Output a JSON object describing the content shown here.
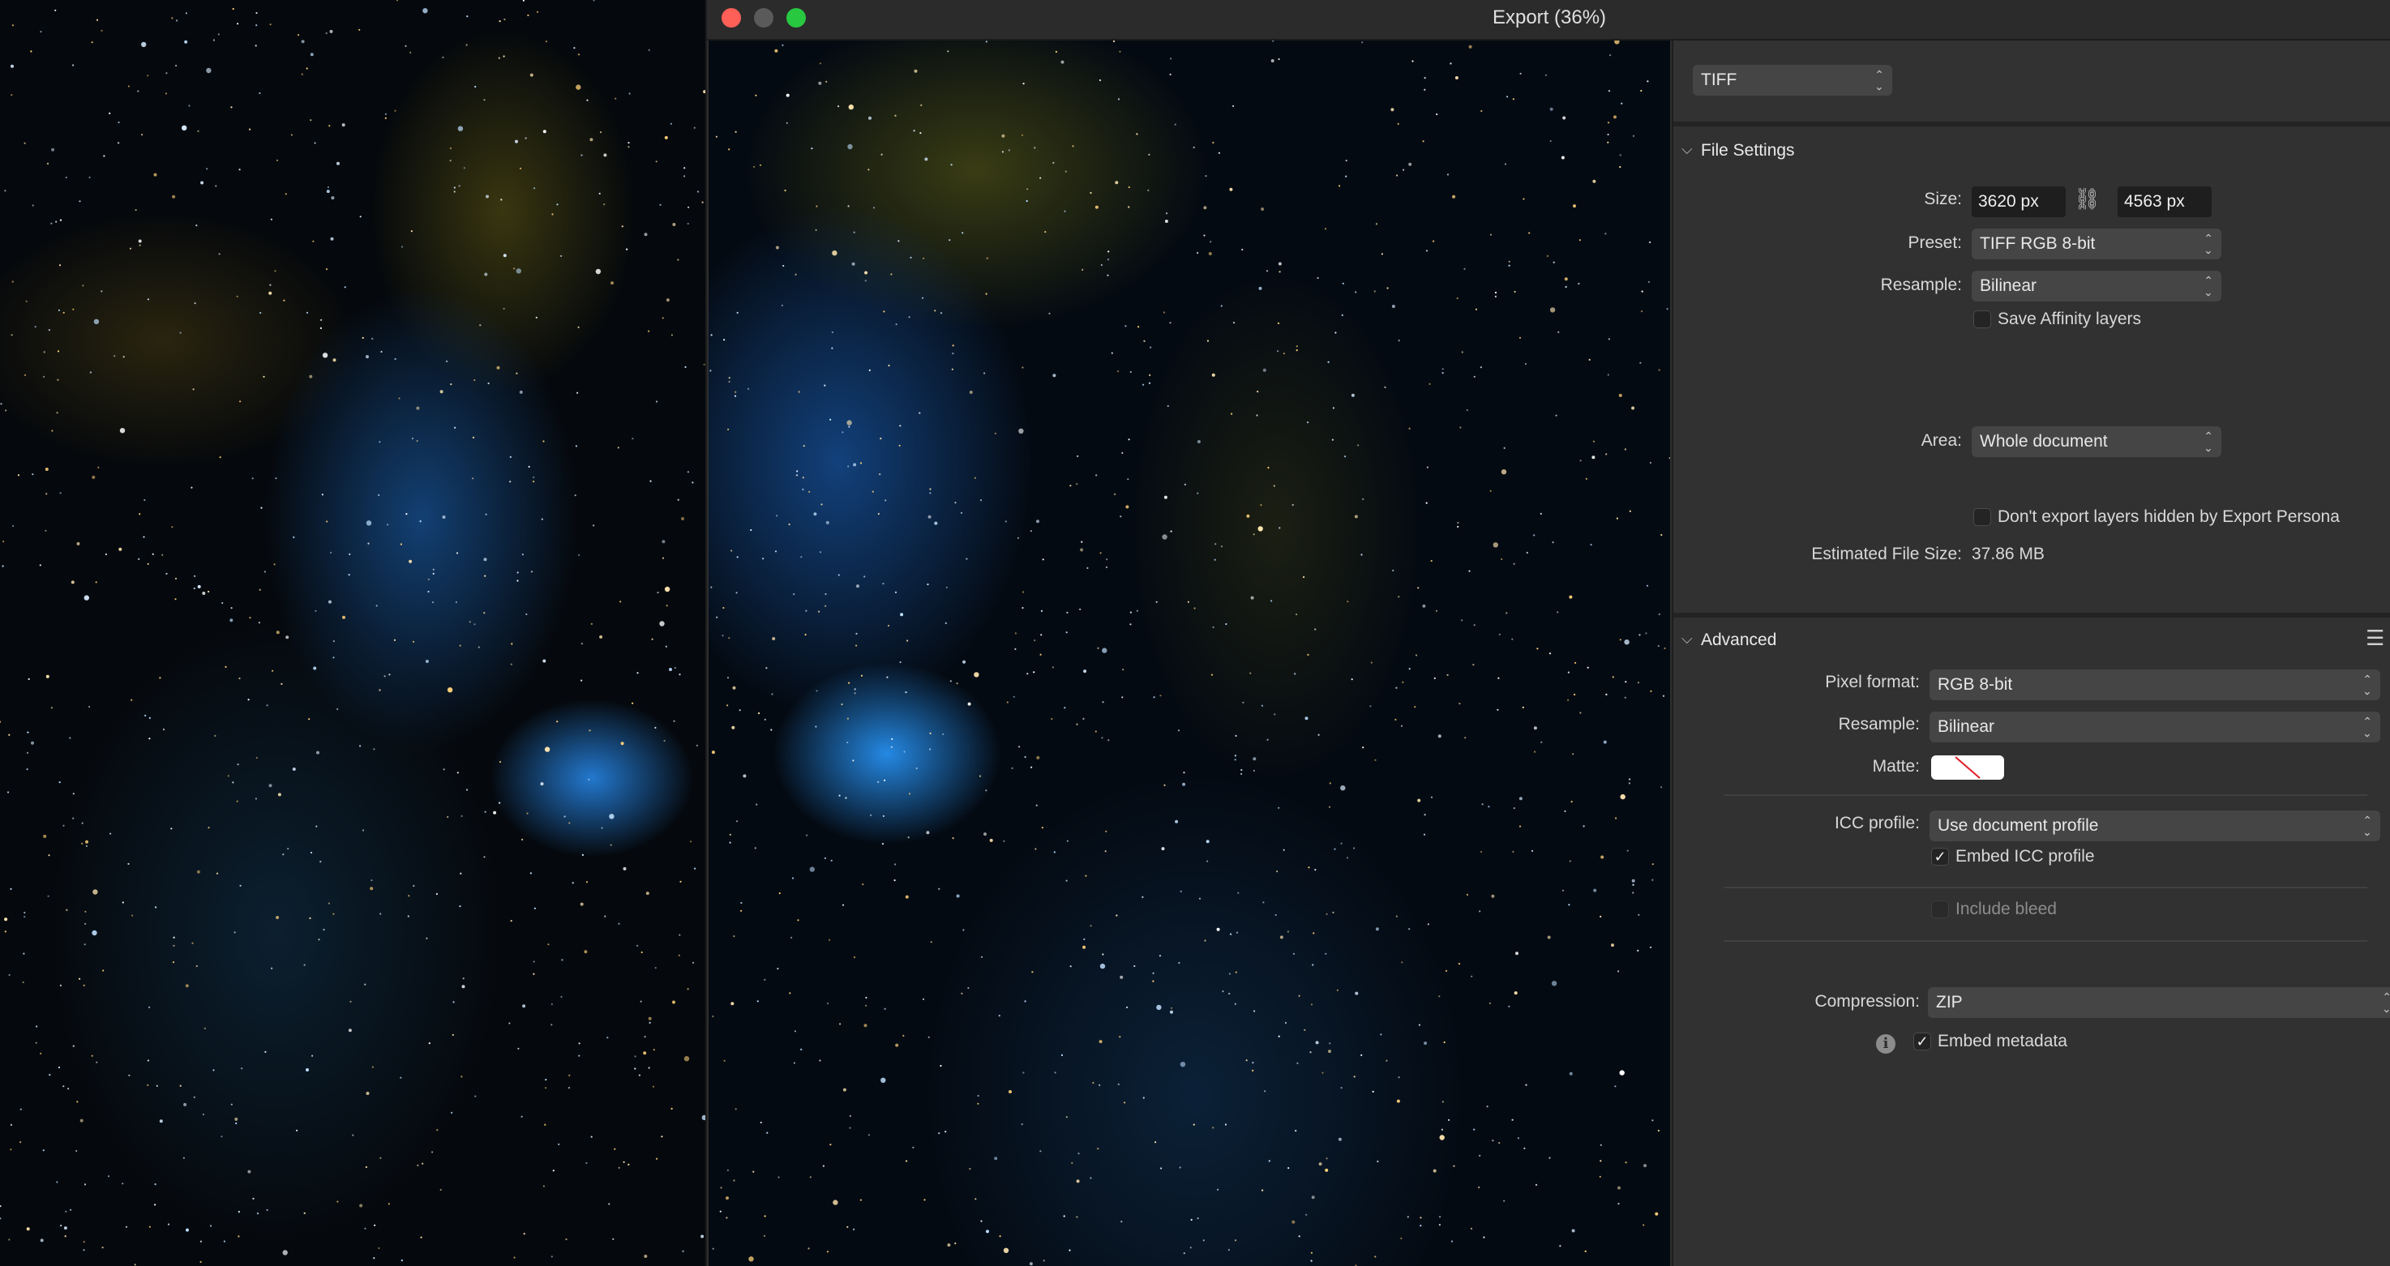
{
  "window": {
    "title": "Export (36%)"
  },
  "format_bar": {
    "format": "TIFF"
  },
  "file_settings": {
    "header": "File Settings",
    "size_label": "Size:",
    "width": "3620 px",
    "height": "4563 px",
    "preset_label": "Preset:",
    "preset": "TIFF RGB 8-bit",
    "resample_label": "Resample:",
    "resample": "Bilinear",
    "save_layers": "Save Affinity layers",
    "area_label": "Area:",
    "area": "Whole document",
    "dont_export_hidden": "Don't export layers hidden by Export Persona",
    "estimated_label": "Estimated File Size:",
    "estimated_value": "37.86 MB"
  },
  "advanced": {
    "header": "Advanced",
    "pixel_format_label": "Pixel format:",
    "pixel_format": "RGB 8-bit",
    "resample_label": "Resample:",
    "resample": "Bilinear",
    "matte_label": "Matte:",
    "icc_label": "ICC profile:",
    "icc": "Use document profile",
    "embed_icc": "Embed ICC profile",
    "include_bleed": "Include bleed",
    "compression_label": "Compression:",
    "compression": "ZIP",
    "embed_metadata": "Embed metadata"
  },
  "icons": {
    "close": "close-icon",
    "minimize": "minimize-icon",
    "maximize": "maximize-icon",
    "link": "link-icon",
    "menu": "menu-icon",
    "info": "info-icon",
    "chevron": "chevron-down-icon",
    "check": "checkmark-icon"
  },
  "colors": {
    "close": "#fe5f57",
    "maximize": "#28c840",
    "panel_bg": "#313131",
    "field_bg": "#1e1e1e",
    "select_bg": "#454545"
  }
}
